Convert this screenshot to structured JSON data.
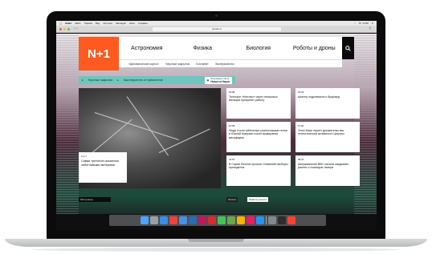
{
  "menubar": {
    "apple": "",
    "app": "Safari",
    "items": [
      "Файл",
      "Правка",
      "Вид",
      "История",
      "Закладки",
      "Окно",
      "Справка"
    ],
    "right": "Пт 14:58"
  },
  "browser": {
    "url": "nplus1.ru"
  },
  "site": {
    "logo": "N+1",
    "nav": [
      "Астрономия",
      "Физика",
      "Биология",
      "Роботы и дроны"
    ],
    "subnav": [
      "«Динамические карты»",
      "Научные закрытия",
      "Блогмейт",
      "Эксперименты"
    ],
    "teal_links": [
      "Научные закрытия",
      "Как нефритить от прямопотов"
    ],
    "promo_label": "Популярные статьи",
    "promo_title": "Новости Науки",
    "hero": {
      "time": "14:17",
      "title": "Самки тритонов оказались заботливыми матерями"
    },
    "cards": [
      {
        "time": "15:08",
        "title": "Телескоп «Кеплер» через несколько месяцев прекратит работу"
      },
      {
        "time": "15:04",
        "title": "Ахиллу подключили к браузеру"
      },
      {
        "time": "12:58",
        "title": "Люди стали гибельные разносчиками генов в Южной Америке после вымирания мегафауны"
      },
      {
        "time": "11:40",
        "title": "Элон Маск нашел доказательства геологической активности Цереры"
      },
      {
        "time": "10:57",
        "title": "В Сирии Леонов прошли Олимпийн выборы президента"
      },
      {
        "time": "09:41",
        "title": "Американские ВВС начали скидывать ракеты с помощью лазера"
      }
    ],
    "bottom": [
      "Материалы",
      "Физика",
      "Памяти ученого"
    ]
  },
  "dock": {
    "apps": [
      "finder",
      "launchpad",
      "safari",
      "chrome",
      "mail",
      "photoshop",
      "indesign",
      "acrobat",
      "messages",
      "maps",
      "photos",
      "itunes",
      "appstore",
      "preferences",
      "terminal",
      "calendar"
    ],
    "colors": [
      "#4da3ff",
      "#9aa0a6",
      "#3a8ee6",
      "#e8453c",
      "#4a90e2",
      "#2b6cb0",
      "#c2185b",
      "#d32f2f",
      "#43c45a",
      "#6aa84f",
      "#f5b400",
      "#e91e63",
      "#2196f3",
      "#7f8c8d",
      "#2d2d2d",
      "#f44336"
    ]
  }
}
